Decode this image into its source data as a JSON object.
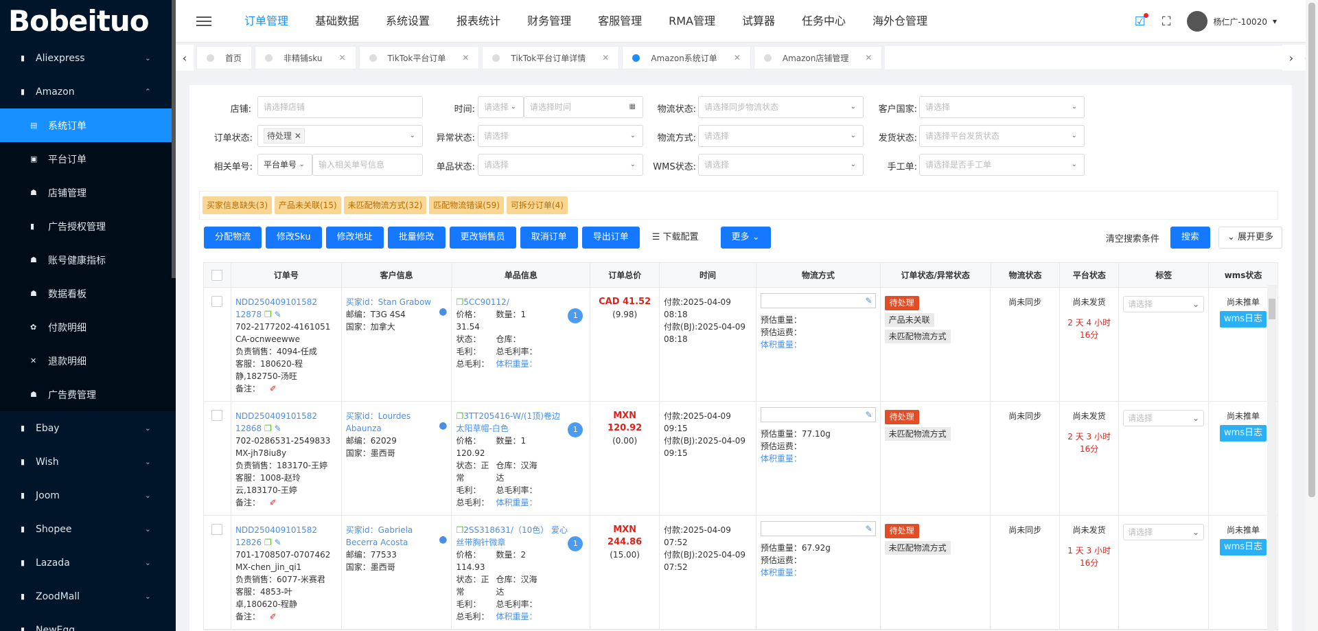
{
  "brand": "Bobeituo",
  "sidebar": {
    "items": [
      {
        "label": "Aliexpress",
        "icon": "file-icon"
      },
      {
        "label": "Amazon",
        "icon": "file-icon"
      }
    ],
    "amazon_sub": [
      {
        "label": "系统订单"
      },
      {
        "label": "平台订单"
      },
      {
        "label": "店铺管理"
      },
      {
        "label": "广告授权管理"
      },
      {
        "label": "账号健康指标"
      },
      {
        "label": "数据看板"
      },
      {
        "label": "付款明细"
      },
      {
        "label": "退款明细"
      },
      {
        "label": "广告费管理"
      }
    ],
    "rest": [
      {
        "label": "Ebay"
      },
      {
        "label": "Wish"
      },
      {
        "label": "Joom"
      },
      {
        "label": "Shopee"
      },
      {
        "label": "Lazada"
      },
      {
        "label": "ZoodMall"
      },
      {
        "label": "NewEgg"
      }
    ]
  },
  "topnav": [
    "订单管理",
    "基础数据",
    "系统设置",
    "报表统计",
    "财务管理",
    "客服管理",
    "RMA管理",
    "试算器",
    "任务中心",
    "海外仓管理"
  ],
  "user": {
    "name": "杨仁广-10020"
  },
  "tabs": [
    "首页",
    "非精铺sku",
    "TikTok平台订单",
    "TikTok平台订单详情",
    "Amazon系统订单",
    "Amazon店铺管理"
  ],
  "filters": {
    "shop_label": "店铺:",
    "shop_ph": "请选择店铺",
    "time_label": "时间:",
    "time_sel": "请选择",
    "time_ph": "请选择时间",
    "logistics_status_label": "物流状态:",
    "logistics_status_ph": "请选择同步物流状态",
    "country_label": "客户国家:",
    "country_ph": "请选择",
    "order_status_label": "订单状态:",
    "order_status_tag": "待处理",
    "abnormal_label": "异常状态:",
    "abnormal_ph": "请选择",
    "logistics_method_label": "物流方式:",
    "logistics_method_ph": "请选择",
    "ship_status_label": "发货状态:",
    "ship_status_ph": "请选择平台发货状态",
    "related_label": "相关单号:",
    "related_sel": "平台单号",
    "related_ph": "输入相关单号信息",
    "item_status_label": "单品状态:",
    "item_status_ph": "请选择",
    "wms_status_label": "WMS状态:",
    "wms_status_ph": "请选择",
    "manual_label": "手工单:",
    "manual_ph": "请选择是否手工单"
  },
  "alerts": [
    "买家信息缺失(3)",
    "产品未关联(15)",
    "未匹配物流方式(32)",
    "匹配物流错误(59)",
    "可拆分订单(4)"
  ],
  "actions": [
    "分配物流",
    "修改Sku",
    "修改地址",
    "批量修改",
    "更改销售员",
    "取消订单",
    "导出订单"
  ],
  "download_config": "下载配置",
  "more": "更多",
  "clear": "清空搜索条件",
  "search": "搜索",
  "expand": "展开更多",
  "columns": [
    "订单号",
    "客户信息",
    "单品信息",
    "订单总价",
    "时间",
    "物流方式",
    "订单状态/异常状态",
    "物流状态",
    "平台状态",
    "标签",
    "wms状态"
  ],
  "rows": [
    {
      "order_no": "NDD250409101582 12878",
      "platform_no": "702-2177202-4161051",
      "ca": "CA-ocnweewwe",
      "seller": "负责销售：4094-任成",
      "service": "客服：180620-程静,182750-汤旺",
      "remark": "备注：",
      "buyer": "买家id：Stan Grabow",
      "zip": "邮编：T3G 4S4",
      "country": "国家：加拿大",
      "sku": "5CC90112/",
      "price": "价格：31.54",
      "qty": "数量：1",
      "status": "状态：",
      "warehouse": "仓库：",
      "profit": "毛利：",
      "profit_rate": "总毛利率：",
      "total_profit": "总毛利：",
      "volume": "体积重量：",
      "item_count": "1",
      "total": "CAD 41.52",
      "sub": "(9.98)",
      "pay_time": "付款:2025-04-09 08:18",
      "pay_time_bj": "付款(BJ):2025-04-09 08:18",
      "est_weight": "预估重量：",
      "est_fee": "预估运费：",
      "vol_weight": "体积重量：",
      "order_status": "待处理",
      "abn": [
        "产品未关联",
        "未匹配物流方式"
      ],
      "log_status": "尚未同步",
      "plat_status": "尚未发货",
      "plat_time": "2 天 4 小时 16分",
      "tag_ph": "请选择",
      "wms_status": "尚未推单",
      "wms_btn": "wms日志"
    },
    {
      "order_no": "NDD250409101582 12868",
      "platform_no": "702-0286531-2549833",
      "ca": "MX-jh78iu8y",
      "seller": "负责销售：183170-王婷",
      "service": "客服：1008-赵玲云,183170-王婷",
      "remark": "备注：",
      "buyer": "买家id：Lourdes Abaunza",
      "zip": "邮编：62029",
      "country": "国家：墨西哥",
      "sku": "3TT205416-W/(1顶)卷边太阳草帽-白色",
      "price": "价格：120.92",
      "qty": "数量：1",
      "status": "状态：正常",
      "warehouse": "仓库：汉海达",
      "profit": "毛利：",
      "profit_rate": "总毛利率：",
      "total_profit": "总毛利：",
      "volume": "体积重量：",
      "item_count": "1",
      "total": "MXN 120.92",
      "sub": "(0.00)",
      "pay_time": "付款:2025-04-09 09:15",
      "pay_time_bj": "付款(BJ):2025-04-09 09:15",
      "est_weight": "预估重量：77.10g",
      "est_fee": "预估运费：",
      "vol_weight": "体积重量：",
      "order_status": "待处理",
      "abn": [
        "未匹配物流方式"
      ],
      "log_status": "尚未同步",
      "plat_status": "尚未发货",
      "plat_time": "2 天 3 小时 16分",
      "tag_ph": "请选择",
      "wms_status": "尚未推单",
      "wms_btn": "wms日志"
    },
    {
      "order_no": "NDD250409101582 12826",
      "platform_no": "701-1708507-0707462",
      "ca": "MX-chen_jin_qi1",
      "seller": "负责销售：6077-米赛君",
      "service": "客服：4853-叶卓,180620-程静",
      "remark": "备注：",
      "buyer": "买家id：Gabriela Becerra Acosta",
      "zip": "邮编：77533",
      "country": "国家：墨西哥",
      "sku": "2SS318631/（10色） 爱心丝带胸针微章",
      "price": "价格：114.93",
      "qty": "数量：2",
      "status": "状态：正常",
      "warehouse": "仓库：汉海达",
      "profit": "毛利：",
      "profit_rate": "总毛利率：",
      "total_profit": "总毛利：",
      "volume": "体积重量：",
      "item_count": "1",
      "total": "MXN 244.86",
      "sub": "(15.00)",
      "pay_time": "付款:2025-04-09 07:52",
      "pay_time_bj": "付款(BJ):2025-04-09 07:52",
      "est_weight": "预估重量：67.92g",
      "est_fee": "预估运费：",
      "vol_weight": "体积重量：",
      "order_status": "待处理",
      "abn": [
        "未匹配物流方式"
      ],
      "log_status": "尚未同步",
      "plat_status": "尚未发货",
      "plat_time": "1 天 3 小时 16分",
      "tag_ph": "请选择",
      "wms_status": "尚未推单",
      "wms_btn": "wms日志"
    }
  ]
}
